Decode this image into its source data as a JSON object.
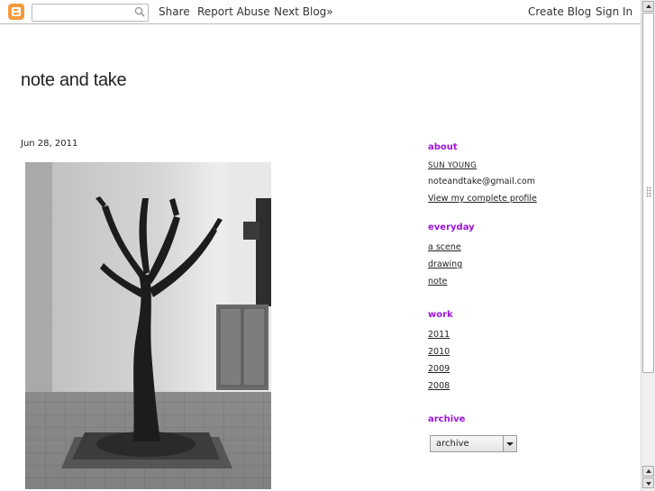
{
  "navbar": {
    "search_placeholder": "",
    "share": "Share",
    "report_abuse": "Report Abuse",
    "next_blog": "Next Blog»",
    "create_blog": "Create Blog",
    "sign_in": "Sign In"
  },
  "blog": {
    "title": "note and take"
  },
  "post": {
    "date": "Jun 28, 2011"
  },
  "sidebar": {
    "about": {
      "title": "about",
      "name": "SUN YOUNG",
      "email": "noteandtake@gmail.com",
      "profile_link": "View my complete profile"
    },
    "everyday": {
      "title": "everyday",
      "items": [
        "a scene",
        "drawing",
        "note"
      ]
    },
    "work": {
      "title": "work",
      "items": [
        "2011",
        "2010",
        "2009",
        "2008"
      ]
    },
    "archive": {
      "title": "archive",
      "selected": "archive"
    }
  },
  "colors": {
    "widget_title": "#9d12d6",
    "blogger_orange": "#f59a3b"
  }
}
